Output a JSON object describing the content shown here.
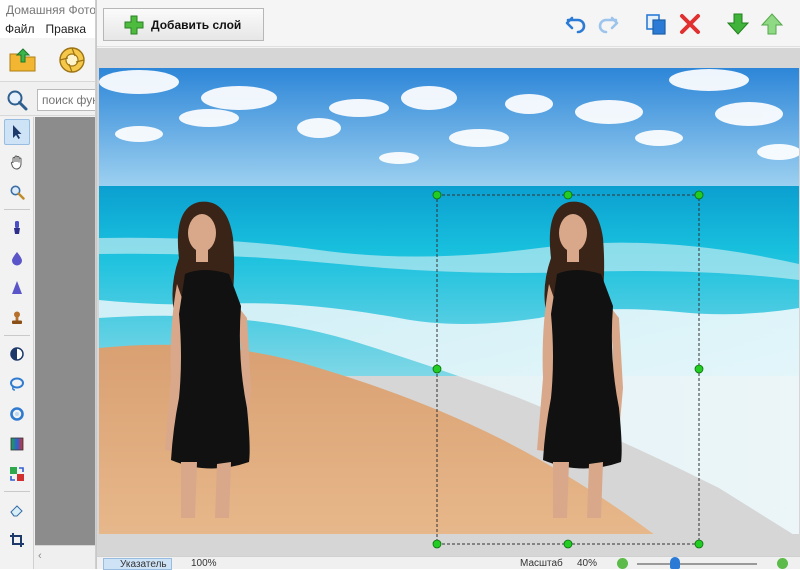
{
  "app": {
    "title": "Домашняя Фотостудия",
    "menu": [
      "Файл",
      "Правка"
    ],
    "search": {
      "placeholder": "поиск функций"
    }
  },
  "dialog": {
    "add_layer_label": "Добавить слой"
  },
  "status": {
    "pointer_label": "Указатель",
    "fit_label": "100%",
    "scale_label": "Масштаб",
    "scale_value": "40%",
    "zoom_level": 0.3
  },
  "colors": {
    "accent": "#2b7bd6",
    "handle": "#22cc22",
    "delete": "#e03030",
    "move_down": "#3fb33a",
    "move_up": "#8fd884"
  },
  "icons": {
    "toolbar": [
      "pointer-icon",
      "hand-icon",
      "magnifier-icon",
      "brush-icon",
      "blur-drop-icon",
      "sharpen-cone-icon",
      "stamp-icon",
      "dodge-icon",
      "lasso-icon",
      "ring-icon",
      "gradient-icon",
      "replace-color-icon",
      "eraser-icon",
      "crop-icon"
    ],
    "top_bar": [
      "undo-icon",
      "redo-icon",
      "copy-icon",
      "delete-icon",
      "move-down-icon",
      "move-up-icon"
    ]
  }
}
